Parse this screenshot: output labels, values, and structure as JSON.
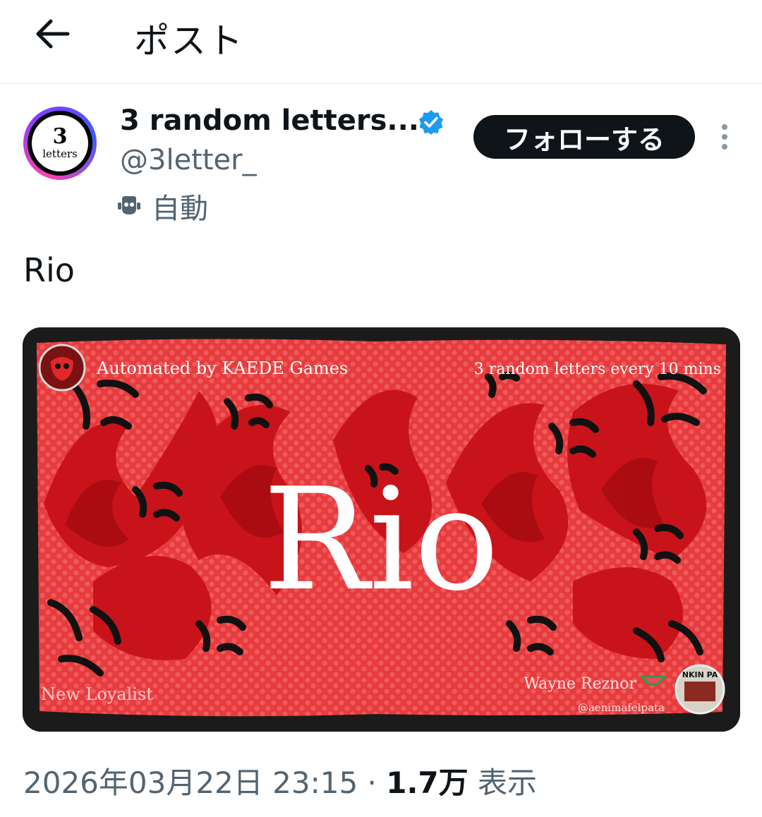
{
  "header": {
    "title": "ポスト",
    "back_icon": "arrow-left-icon"
  },
  "account": {
    "display_name": "3 random letters...",
    "handle": "@3letter_",
    "verified_icon": "verified-badge-icon",
    "automated_label": "自動",
    "automated_icon": "robot-icon",
    "avatar": {
      "number": "3",
      "word": "letters"
    }
  },
  "actions": {
    "follow_label": "フォローする",
    "more_icon": "more-vertical-icon"
  },
  "post": {
    "text": "Rio",
    "image": {
      "main_word": "Rio",
      "top_left": "Automated by KAEDE Games",
      "top_right": "3 random letters every 10 mins",
      "bottom_left": "New Loyalist",
      "bottom_right": "Wayne Reznor",
      "bottom_handle": "@aenimafelpata",
      "album_text": "NKIN PA",
      "colors": {
        "background": "#e0262a",
        "accent": "#b60f14",
        "text": "#ffffff"
      }
    }
  },
  "meta": {
    "datetime": "2026年03月22日 23:15",
    "separator": "·",
    "views": "1.7万",
    "views_label": "表示"
  }
}
